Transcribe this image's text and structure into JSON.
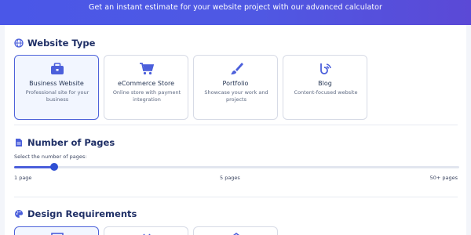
{
  "header": {
    "subtitle": "Get an instant estimate for your website project with our advanced calculator"
  },
  "website_type": {
    "title": "Website Type",
    "icon": "globe-icon",
    "options": [
      {
        "title": "Business Website",
        "desc": "Professional site for your business",
        "icon": "briefcase-icon",
        "selected": true
      },
      {
        "title": "eCommerce Store",
        "desc": "Online store with payment integration",
        "icon": "shopping-cart-icon",
        "selected": false
      },
      {
        "title": "Portfolio",
        "desc": "Showcase your work and projects",
        "icon": "paint-brush-icon",
        "selected": false
      },
      {
        "title": "Blog",
        "desc": "Content-focused website",
        "icon": "blog-icon",
        "selected": false
      }
    ]
  },
  "pages": {
    "title": "Number of Pages",
    "icon": "document-icon",
    "label": "Select the number of pages:",
    "slider_fraction": 0.09,
    "tick_min": "1 page",
    "tick_mid": "5 pages",
    "tick_max": "50+ pages"
  },
  "design": {
    "title": "Design Requirements",
    "icon": "palette-icon",
    "option_icons": [
      "layout-icon",
      "code-icon",
      "settings-icon"
    ],
    "selected_index": 0
  },
  "colors": {
    "accent": "#4b5fdb",
    "header_start": "#4a57e8",
    "header_end": "#5b49d6",
    "title": "#1f2f66"
  }
}
